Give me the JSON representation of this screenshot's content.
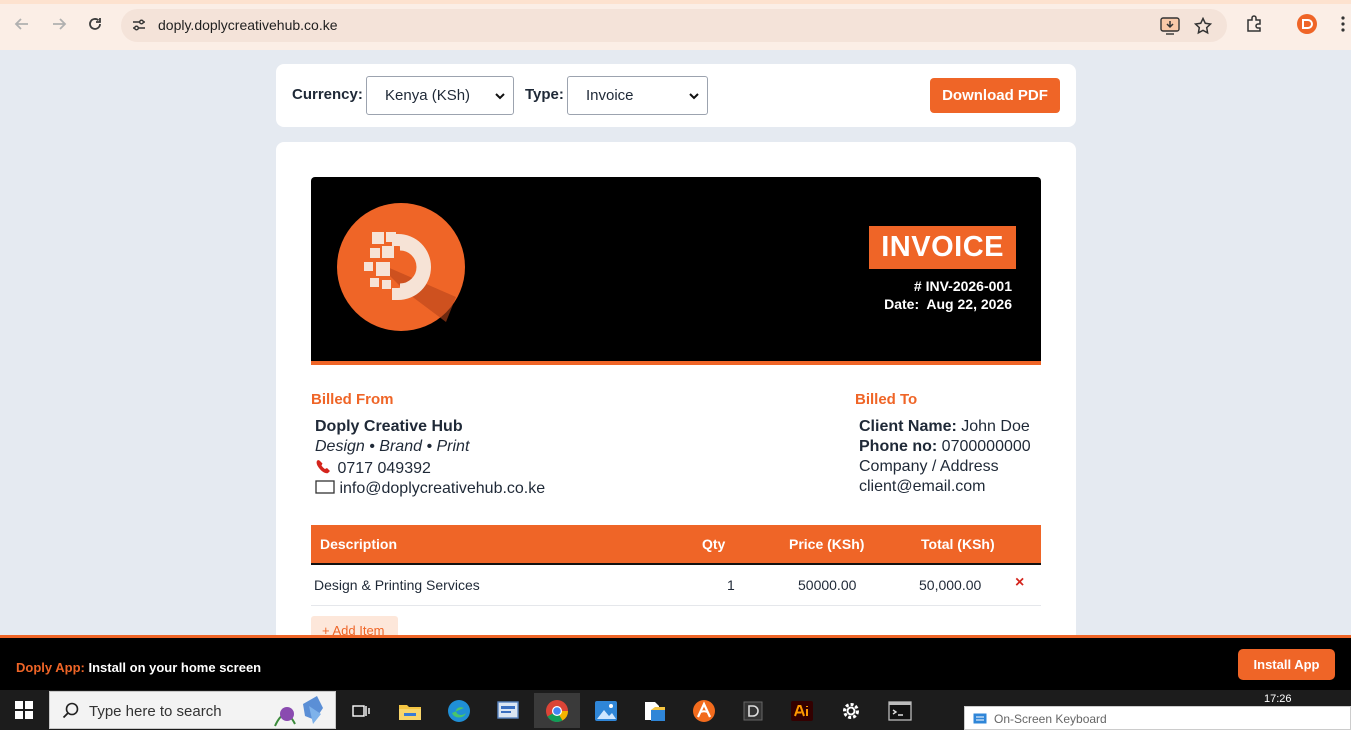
{
  "browser": {
    "url": "doply.doplycreativehub.co.ke"
  },
  "toolbar": {
    "currency_label": "Currency:",
    "currency_value": "Kenya (KSh)",
    "type_label": "Type:",
    "type_value": "Invoice",
    "download_label": "Download PDF"
  },
  "invoice": {
    "badge": "INVOICE",
    "number": "# INV-2026-001",
    "date_label": "Date:",
    "date_value": "Aug 22, 2026"
  },
  "billed_from": {
    "heading": "Billed From",
    "company": "Doply Creative Hub",
    "tagline": "Design • Brand • Print",
    "phone": "0717 049392",
    "email": "info@doplycreativehub.co.ke"
  },
  "billed_to": {
    "heading": "Billed To",
    "client_label": "Client Name:",
    "client_value": "John Doe",
    "phone_label": "Phone no:",
    "phone_value": "0700000000",
    "address": "Company / Address",
    "email": "client@email.com"
  },
  "table": {
    "headers": [
      "Description",
      "Qty",
      "Price (KSh)",
      "Total (KSh)"
    ],
    "rows": [
      {
        "description": "Design & Printing Services",
        "qty": "1",
        "price": "50000.00",
        "total": "50,000.00",
        "remove": "×"
      }
    ],
    "add_item": "+ Add Item"
  },
  "install_banner": {
    "brand": "Doply App:",
    "text": "Install on your home screen",
    "button": "Install App"
  },
  "taskbar": {
    "search_placeholder": "Type here to search",
    "osk_label": "On-Screen Keyboard",
    "time": "17:26"
  },
  "colors": {
    "accent": "#ef6527",
    "header_bg": "#000000",
    "page_bg": "#e5eaf1"
  }
}
